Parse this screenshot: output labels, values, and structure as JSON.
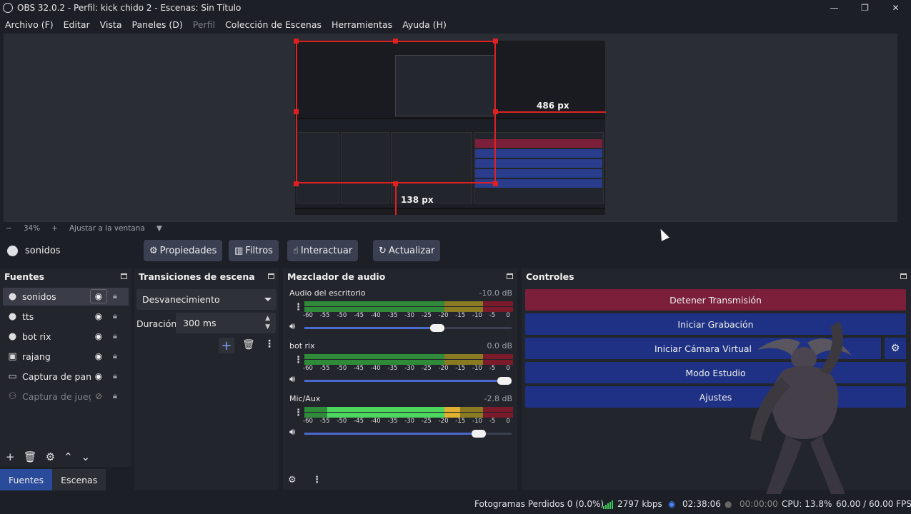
{
  "window": {
    "title": "OBS 32.0.2 - Perfil: kick chido 2 - Escenas: Sin Título",
    "controls": [
      "—",
      "❐",
      "✕"
    ]
  },
  "menu": [
    {
      "label": "Archivo (F)",
      "disabled": false
    },
    {
      "label": "Editar",
      "disabled": false
    },
    {
      "label": "Vista",
      "disabled": false
    },
    {
      "label": "Paneles (D)",
      "disabled": false
    },
    {
      "label": "Perfil",
      "disabled": true
    },
    {
      "label": "Colección de Escenas",
      "disabled": false
    },
    {
      "label": "Herramientas",
      "disabled": false
    },
    {
      "label": "Ayuda (H)",
      "disabled": false
    }
  ],
  "preview": {
    "width_label": "486 px",
    "height_label": "138 px"
  },
  "zoom": {
    "minus": "−",
    "level": "34%",
    "plus": "+",
    "fit_label": "Ajustar a la ventana"
  },
  "source_toolbar": {
    "selected_source": "sonidos",
    "properties": "Propiedades",
    "filters": "Filtros",
    "interact": "Interactuar",
    "refresh": "Actualizar"
  },
  "sources_dock": {
    "title": "Fuentes",
    "items": [
      {
        "name": "sonidos",
        "icon": "globe-icon",
        "visible": true,
        "selected": true
      },
      {
        "name": "tts",
        "icon": "globe-icon",
        "visible": true,
        "selected": false
      },
      {
        "name": "bot rix",
        "icon": "globe-icon",
        "visible": true,
        "selected": false
      },
      {
        "name": "rajang",
        "icon": "image-icon",
        "visible": true,
        "selected": false
      },
      {
        "name": "Captura de pantalla",
        "icon": "monitor-icon",
        "visible": true,
        "selected": false
      },
      {
        "name": "Captura de juego",
        "icon": "gamepad-icon",
        "visible": false,
        "selected": false
      }
    ]
  },
  "tabs": {
    "sources": "Fuentes",
    "scenes": "Escenas"
  },
  "transitions_dock": {
    "title": "Transiciones de escena",
    "transition": "Desvanecimiento",
    "duration_label": "Duración",
    "duration_value": "300 ms"
  },
  "mixer_dock": {
    "title": "Mezclador de audio",
    "channels": [
      {
        "name": "Audio del escritorio",
        "db": "-10.0 dB",
        "volume_pct": 64
      },
      {
        "name": "bot rix",
        "db": "0.0 dB",
        "volume_pct": 100
      },
      {
        "name": "Mic/Aux",
        "db": "-2.8 dB",
        "volume_pct": 84
      }
    ],
    "ticks": [
      "-60",
      "-55",
      "-50",
      "-45",
      "-40",
      "-35",
      "-30",
      "-25",
      "-20",
      "-15",
      "-10",
      "-5",
      "0"
    ]
  },
  "controls_dock": {
    "title": "Controles",
    "stop_stream": "Detener Transmisión",
    "start_recording": "Iniciar Grabación",
    "start_virtual_cam": "Iniciar Cámara Virtual",
    "studio_mode": "Modo Estudio",
    "settings": "Ajustes"
  },
  "status": {
    "dropped_frames": "Fotogramas Perdidos 0 (0.0%)",
    "bitrate": "2797 kbps",
    "stream_time": "02:38:06",
    "rec_time": "00:00:00",
    "cpu": "CPU: 13.8%",
    "fps": "60.00 / 60.00 FPS"
  },
  "colors": {
    "accent": "#2a4a9a",
    "stop_stream": "#7c1f3a",
    "control_button": "#1e3184",
    "meter_green": "#2f8a3a",
    "meter_yellow": "#8a7a22",
    "meter_red": "#7a1a2a"
  }
}
